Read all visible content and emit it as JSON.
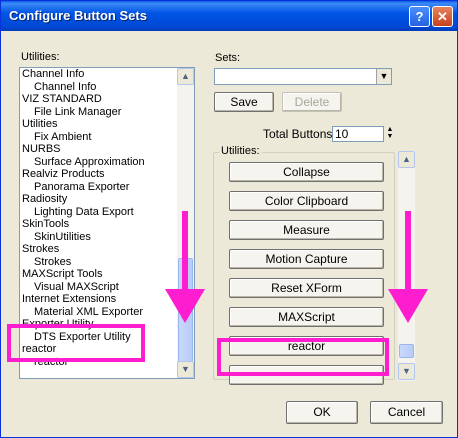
{
  "window": {
    "title": "Configure Button Sets",
    "help_glyph": "?",
    "close_glyph": "✕"
  },
  "utilities_label": "Utilities:",
  "utilities_list": [
    {
      "label": "Channel Info",
      "sub": false
    },
    {
      "label": "Channel Info",
      "sub": true
    },
    {
      "label": "VIZ STANDARD",
      "sub": false
    },
    {
      "label": "File Link Manager",
      "sub": true
    },
    {
      "label": "Utilities",
      "sub": false
    },
    {
      "label": "Fix Ambient",
      "sub": true
    },
    {
      "label": "NURBS",
      "sub": false
    },
    {
      "label": "Surface Approximation",
      "sub": true
    },
    {
      "label": "Realviz Products",
      "sub": false
    },
    {
      "label": "Panorama Exporter",
      "sub": true
    },
    {
      "label": "Radiosity",
      "sub": false
    },
    {
      "label": "Lighting Data Export",
      "sub": true
    },
    {
      "label": "SkinTools",
      "sub": false
    },
    {
      "label": "SkinUtilities",
      "sub": true
    },
    {
      "label": "Strokes",
      "sub": false
    },
    {
      "label": "Strokes",
      "sub": true
    },
    {
      "label": "MAXScript Tools",
      "sub": false
    },
    {
      "label": "Visual MAXScript",
      "sub": true
    },
    {
      "label": "Internet Extensions",
      "sub": false
    },
    {
      "label": "Material XML Exporter",
      "sub": true
    },
    {
      "label": "Exporter Utility",
      "sub": false
    },
    {
      "label": "DTS Exporter Utility",
      "sub": true
    },
    {
      "label": "reactor",
      "sub": false
    },
    {
      "label": "reactor",
      "sub": true
    }
  ],
  "sets": {
    "label": "Sets:",
    "value": "",
    "save_label": "Save",
    "delete_label": "Delete"
  },
  "total_buttons": {
    "label": "Total Buttons:",
    "value": "10"
  },
  "group_title": "Utilities:",
  "utility_buttons": [
    "Collapse",
    "Color Clipboard",
    "Measure",
    "Motion Capture",
    "Reset XForm",
    "MAXScript",
    "reactor",
    ""
  ],
  "ok_label": "OK",
  "cancel_label": "Cancel",
  "colors": {
    "highlight": "#ff1ecf",
    "titlebar": "#0055e5"
  },
  "scroll_glyphs": {
    "up": "▲",
    "down": "▼",
    "combo": "▼"
  }
}
